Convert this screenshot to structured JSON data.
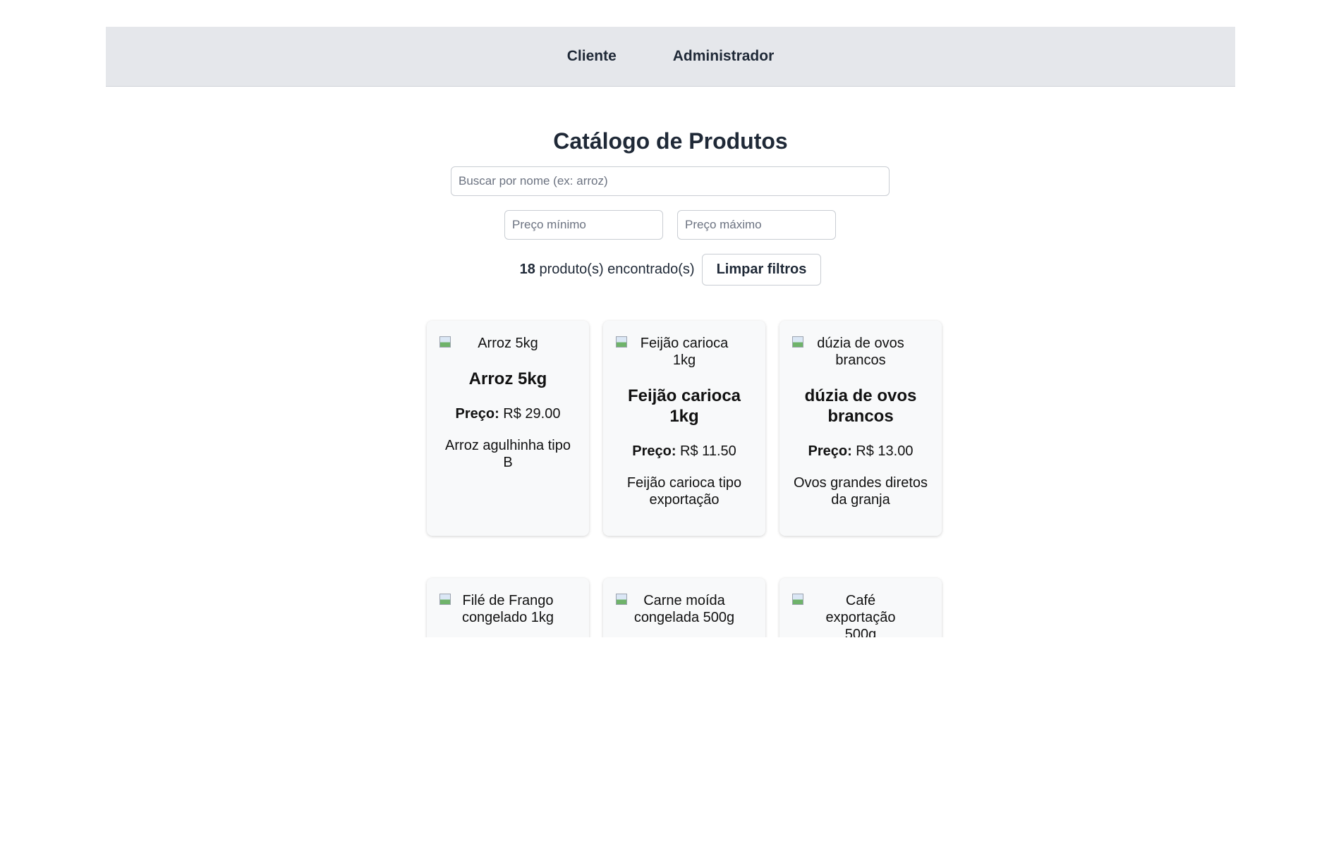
{
  "nav": {
    "items": [
      {
        "label": "Cliente"
      },
      {
        "label": "Administrador"
      }
    ]
  },
  "page": {
    "title": "Catálogo de Produtos"
  },
  "filters": {
    "search_placeholder": "Buscar por nome (ex: arroz)",
    "search_value": "",
    "min_price_placeholder": "Preço mínimo",
    "max_price_placeholder": "Preço máximo",
    "clear_label": "Limpar filtros"
  },
  "results": {
    "count": "18",
    "count_suffix": " produto(s) encontrado(s)"
  },
  "products": [
    {
      "img_alt": "Arroz 5kg",
      "name": "Arroz 5kg",
      "price_label": "Preço:",
      "price": " R$ 29.00",
      "description": "Arroz agulhinha tipo B"
    },
    {
      "img_alt": "Feijão carioca 1kg",
      "name": "Feijão carioca 1kg",
      "price_label": "Preço:",
      "price": " R$ 11.50",
      "description": "Feijão carioca tipo exportação"
    },
    {
      "img_alt": "dúzia de ovos brancos",
      "name": "dúzia de ovos brancos",
      "price_label": "Preço:",
      "price": " R$ 13.00",
      "description": "Ovos grandes diretos da granja"
    },
    {
      "img_alt": "Filé de Frango congelado 1kg",
      "name": "",
      "price_label": "",
      "price": "",
      "description": ""
    },
    {
      "img_alt": "Carne moída congelada 500g",
      "name": "",
      "price_label": "",
      "price": "",
      "description": ""
    },
    {
      "img_alt": "Café exportação 500g",
      "name": "",
      "price_label": "",
      "price": "",
      "description": ""
    }
  ],
  "icons": {
    "broken_image": "broken-image-icon"
  }
}
